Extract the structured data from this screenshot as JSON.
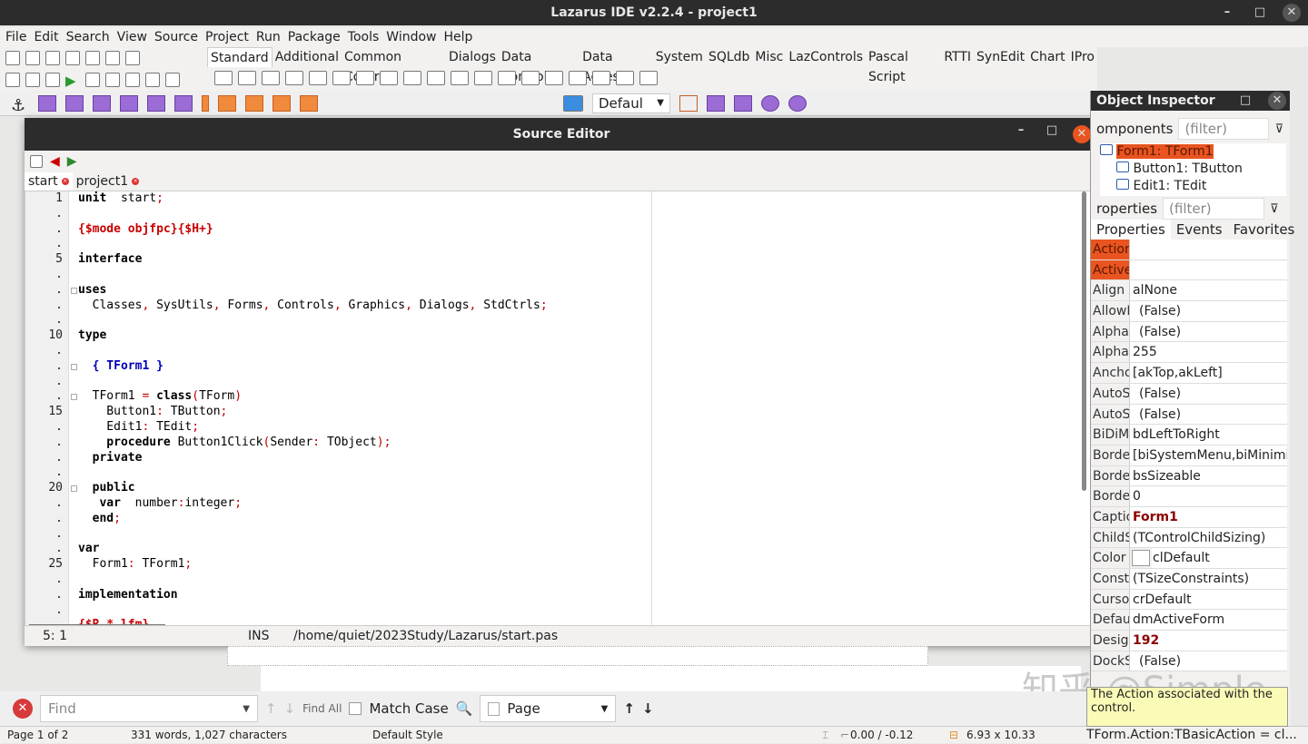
{
  "window": {
    "title": "Lazarus IDE v2.2.4 - project1",
    "minimize": "–",
    "maximize": "□",
    "close": "✕"
  },
  "menu": [
    "File",
    "Edit",
    "Search",
    "View",
    "Source",
    "Project",
    "Run",
    "Package",
    "Tools",
    "Window",
    "Help"
  ],
  "palette": {
    "tabs": [
      "Standard",
      "Additional",
      "Common Controls",
      "Dialogs",
      "Data Controls",
      "Data Access",
      "System",
      "SQLdb",
      "Misc",
      "LazControls",
      "Pascal Script",
      "RTTI",
      "SynEdit",
      "Chart",
      "IPro"
    ],
    "active_tab": "Standard",
    "icons": [
      "pointer-icon",
      "tmainmenu-icon",
      "tpopupmenu-icon",
      "tbutton-icon",
      "tlabel-icon",
      "tedit-icon",
      "tmemo-icon",
      "ttogglebox-icon",
      "tcheckbox-icon",
      "tradiobutton-icon",
      "tlistbox-icon",
      "tcombobox-icon",
      "tscrollbar-icon",
      "tgroupbox-icon",
      "tradiogroup-icon",
      "tcheckgroup-icon",
      "tpanel-icon",
      "tframe-icon",
      "tactionlist-icon"
    ]
  },
  "toolbar": {
    "row1_icons": [
      "new-unit-icon",
      "new-form-icon",
      "open-icon",
      "save-icon",
      "save-all-icon",
      "toggle-form-unit-icon",
      "view-forms-icon"
    ],
    "row2_icons": [
      "view-units-icon",
      "view-forms-icon",
      "build-mode-icon",
      "run-icon",
      "pause-icon",
      "stop-icon",
      "step-into-icon",
      "step-over-icon",
      "step-out-icon"
    ]
  },
  "background_toolbar": {
    "style_value": "Defaul"
  },
  "source_editor": {
    "title": "Source Editor",
    "tabs": [
      {
        "label": "start"
      },
      {
        "label": "project1"
      }
    ],
    "gutter": [
      "1",
      ".",
      ".",
      ".",
      "5",
      ".",
      ".",
      ".",
      ".",
      "10",
      ".",
      ".",
      ".",
      ".",
      "15",
      ".",
      ".",
      ".",
      ".",
      "20",
      ".",
      ".",
      ".",
      ".",
      "25",
      ".",
      ".",
      "."
    ],
    "lines": [
      [
        [
          "kw",
          "unit"
        ],
        [
          "",
          "  start"
        ],
        [
          "sym",
          ";"
        ]
      ],
      [],
      [
        [
          "dir",
          "{$mode objfpc}{$H+}"
        ]
      ],
      [],
      [
        [
          "kw",
          "interface"
        ]
      ],
      [],
      [
        [
          "kw",
          "uses"
        ]
      ],
      [
        [
          "",
          "  Classes"
        ],
        [
          "sym",
          ","
        ],
        [
          "",
          " SysUtils"
        ],
        [
          "sym",
          ","
        ],
        [
          "",
          " Forms"
        ],
        [
          "sym",
          ","
        ],
        [
          "",
          " Controls"
        ],
        [
          "sym",
          ","
        ],
        [
          "",
          " Graphics"
        ],
        [
          "sym",
          ","
        ],
        [
          "",
          " Dialogs"
        ],
        [
          "sym",
          ","
        ],
        [
          "",
          " StdCtrls"
        ],
        [
          "sym",
          ";"
        ]
      ],
      [],
      [
        [
          "kw",
          "type"
        ]
      ],
      [],
      [
        [
          "com",
          "  { TForm1 }"
        ]
      ],
      [],
      [
        [
          "",
          "  TForm1 "
        ],
        [
          "sym",
          "="
        ],
        [
          "",
          " "
        ],
        [
          "kw",
          "class"
        ],
        [
          "sym",
          "("
        ],
        [
          "",
          "TForm"
        ],
        [
          "sym",
          ")"
        ]
      ],
      [
        [
          "",
          "    Button1"
        ],
        [
          "sym",
          ":"
        ],
        [
          "",
          " TButton"
        ],
        [
          "sym",
          ";"
        ]
      ],
      [
        [
          "",
          "    Edit1"
        ],
        [
          "sym",
          ":"
        ],
        [
          "",
          " TEdit"
        ],
        [
          "sym",
          ";"
        ]
      ],
      [
        [
          "kw",
          "    procedure"
        ],
        [
          "",
          " Button1Click"
        ],
        [
          "sym",
          "("
        ],
        [
          "",
          "Sender"
        ],
        [
          "sym",
          ":"
        ],
        [
          "",
          " TObject"
        ],
        [
          "sym",
          ");"
        ]
      ],
      [
        [
          "kw",
          "  private"
        ]
      ],
      [],
      [
        [
          "kw",
          "  public"
        ]
      ],
      [
        [
          "kw",
          "   var"
        ],
        [
          "",
          "  number"
        ],
        [
          "sym",
          ":"
        ],
        [
          "",
          "integer"
        ],
        [
          "sym",
          ";"
        ]
      ],
      [
        [
          "kw",
          "  end"
        ],
        [
          "sym",
          ";"
        ]
      ],
      [],
      [
        [
          "kw",
          "var"
        ]
      ],
      [
        [
          "",
          "  Form1"
        ],
        [
          "sym",
          ":"
        ],
        [
          "",
          " TForm1"
        ],
        [
          "sym",
          ";"
        ]
      ],
      [],
      [
        [
          "kw",
          "implementation"
        ]
      ],
      [],
      [
        [
          "dir",
          "{$R *.lfm}"
        ]
      ]
    ],
    "status": {
      "position": "5:  1",
      "mode": "INS",
      "path": "/home/quiet/2023Study/Lazarus/start.pas"
    }
  },
  "object_inspector": {
    "title": "Object Inspector",
    "components_label": "omponents",
    "filter_placeholder": "(filter)",
    "tree": [
      "Form1: TForm1",
      "Button1: TButton",
      "Edit1: TEdit"
    ],
    "properties_label": "roperties",
    "tabs": [
      "Properties",
      "Events",
      "Favorites"
    ],
    "properties": [
      {
        "name": "Action",
        "value": ""
      },
      {
        "name": "Active",
        "value": ""
      },
      {
        "name": "Align",
        "value": "alNone"
      },
      {
        "name": "AllowD",
        "value": "(False)"
      },
      {
        "name": "AlphaB",
        "value": "(False)"
      },
      {
        "name": "AlphaB",
        "value": "255"
      },
      {
        "name": "Ancho",
        "value": "[akTop,akLeft]"
      },
      {
        "name": "AutoSc",
        "value": "(False)"
      },
      {
        "name": "AutoSi",
        "value": "(False)"
      },
      {
        "name": "BiDiM",
        "value": "bdLeftToRight"
      },
      {
        "name": "Borde",
        "value": "[biSystemMenu,biMinimi"
      },
      {
        "name": "Borde",
        "value": "bsSizeable"
      },
      {
        "name": "Borde",
        "value": "0"
      },
      {
        "name": "Captio",
        "value": "Form1"
      },
      {
        "name": "ChildS",
        "value": "(TControlChildSizing)"
      },
      {
        "name": "Color",
        "value": "clDefault"
      },
      {
        "name": "Constr",
        "value": "(TSizeConstraints)"
      },
      {
        "name": "Cursor",
        "value": "crDefault"
      },
      {
        "name": "Defaul",
        "value": "dmActiveForm"
      },
      {
        "name": "Design",
        "value": "192"
      },
      {
        "name": "DockS",
        "value": "(False)"
      }
    ],
    "hint": "The Action associated with the control.",
    "status": "TForm.Action:TBasicAction = cl..."
  },
  "findbar": {
    "placeholder": "Find",
    "find_all": "Find All",
    "match_case": "Match Case",
    "page_select": "Page"
  },
  "statusbar": {
    "page": "Page 1 of 2",
    "words": "331 words, 1,027 characters",
    "style": "Default Style",
    "position": "0.00 / -0.12",
    "size": "6.93 x 10.33"
  },
  "watermark": "知乎 @Simple",
  "colors": {
    "accent": "#e95420",
    "titlebar": "#2c2c2c",
    "bold_value": "#8b0000"
  }
}
